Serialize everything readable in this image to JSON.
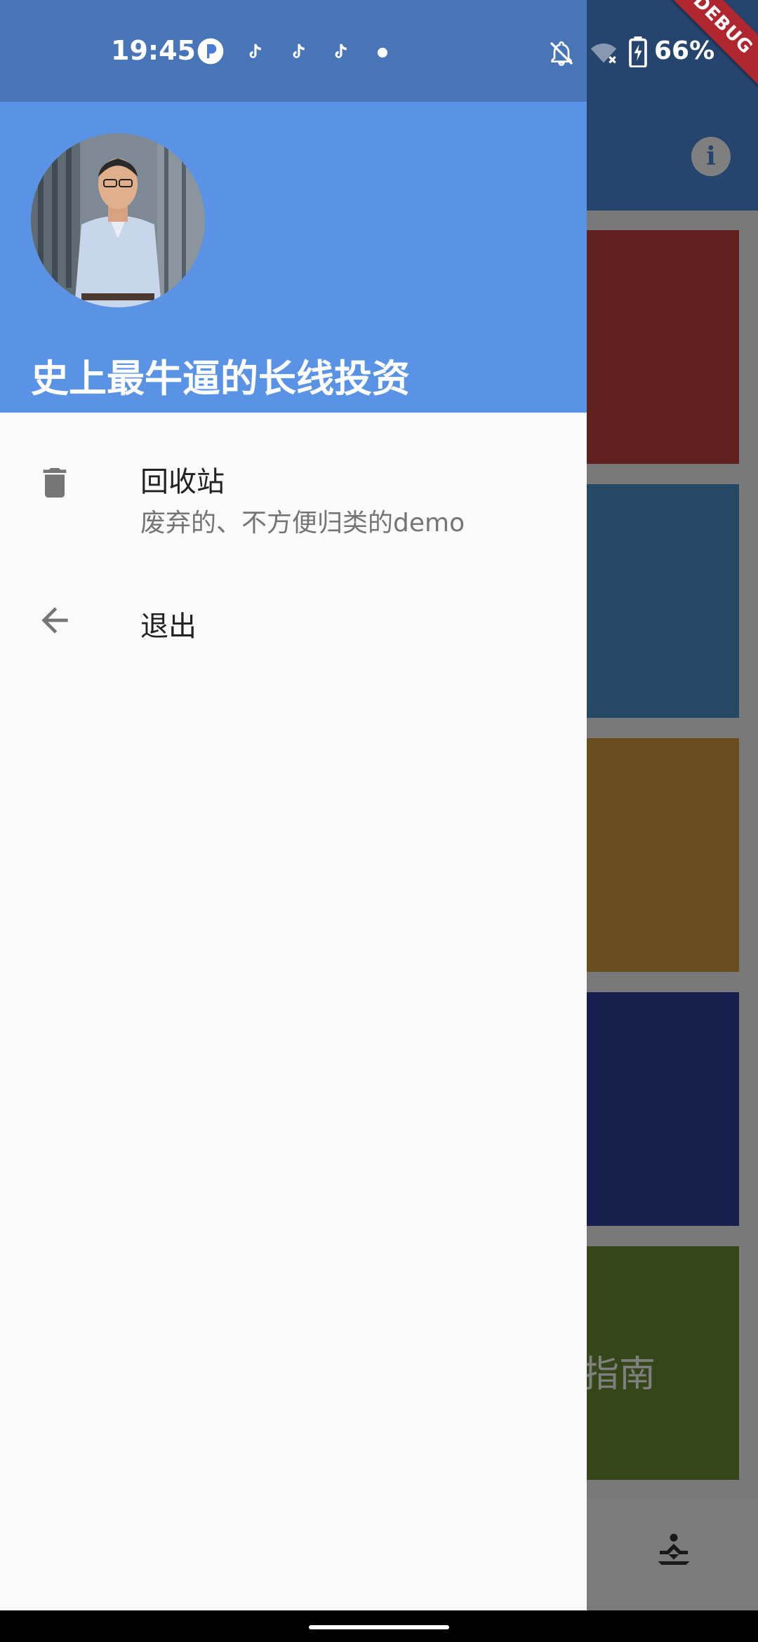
{
  "status_bar": {
    "time": "19:45",
    "battery_percent": "66%",
    "icons": [
      "p-app-icon",
      "tiktok-icon",
      "tiktok-icon",
      "tiktok-icon",
      "dot-icon",
      "bell-off-icon",
      "wifi-off-icon",
      "battery-charging-icon"
    ]
  },
  "debug_banner": {
    "label": "DEBUG"
  },
  "drawer": {
    "header": {
      "title": "史上最牛逼的长线投资",
      "background_color": "#5a93e6",
      "avatar": "avatar-photo"
    },
    "items": [
      {
        "title": "回收站",
        "subtitle": "废弃的、不方便归类的demo",
        "icon": "trash-icon"
      },
      {
        "title": "退出",
        "icon": "arrow-back-icon"
      }
    ]
  },
  "background_app": {
    "appbar_action": "info-icon",
    "cards": [
      {
        "color": "#c0433c"
      },
      {
        "color": "#4a90c9"
      },
      {
        "color": "#d39b3d"
      },
      {
        "color": "#2f3f9e"
      },
      {
        "color": "#6b8f33",
        "label": "指南"
      }
    ],
    "bottom_icon": "meditation-icon"
  }
}
